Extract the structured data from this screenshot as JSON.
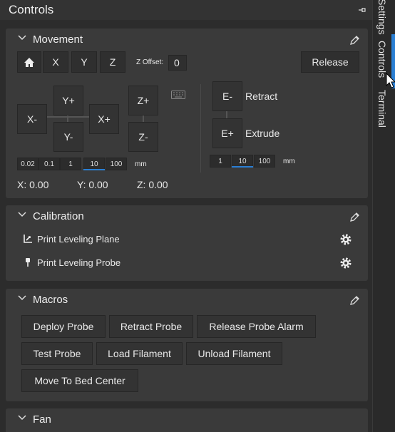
{
  "window": {
    "title": "Controls"
  },
  "movement": {
    "title": "Movement",
    "home_label": "home",
    "axis_buttons": [
      "X",
      "Y",
      "Z"
    ],
    "zoffset_label": "Z Offset:",
    "zoffset_value": "0",
    "release_label": "Release",
    "jog": {
      "xm": "X-",
      "yp": "Y+",
      "ym": "Y-",
      "xp": "X+",
      "zp": "Z+",
      "zm": "Z-"
    },
    "steps": [
      "0.02",
      "0.1",
      "1",
      "10",
      "100"
    ],
    "steps_selected": "10",
    "steps_unit": "mm",
    "extruder": {
      "em": "E-",
      "ep": "E+",
      "retract": "Retract",
      "extrude": "Extrude"
    },
    "e_steps": [
      "1",
      "10",
      "100"
    ],
    "e_steps_selected": "10",
    "e_unit": "mm",
    "positions": {
      "x": "X: 0.00",
      "y": "Y: 0.00",
      "z": "Z: 0.00"
    }
  },
  "calibration": {
    "title": "Calibration",
    "items": [
      {
        "label": "Print Leveling Plane",
        "icon": "axes-icon"
      },
      {
        "label": "Print Leveling Probe",
        "icon": "probe-icon"
      }
    ]
  },
  "macros": {
    "title": "Macros",
    "buttons": [
      "Deploy Probe",
      "Retract Probe",
      "Release Probe Alarm",
      "Test Probe",
      "Load Filament",
      "Unload Filament",
      "Move To Bed Center"
    ]
  },
  "fan": {
    "title": "Fan"
  },
  "tabs": [
    "Settings",
    "Controls",
    "Terminal"
  ],
  "colors": {
    "accent": "#2a7fd4",
    "panel": "#3a3a3a",
    "background": "#2c2c2c"
  }
}
